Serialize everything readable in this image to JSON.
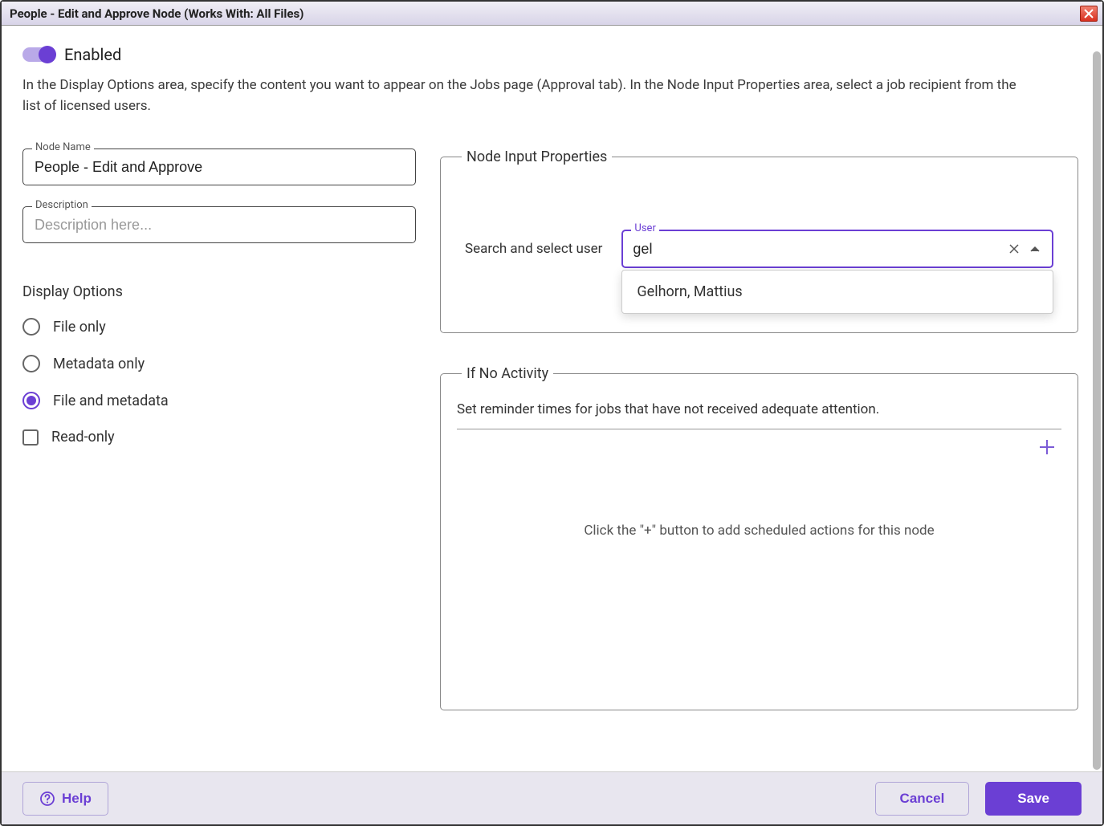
{
  "window": {
    "title": "People - Edit and Approve Node (Works With: All Files)"
  },
  "toggle": {
    "label": "Enabled",
    "state": "on"
  },
  "intro": "In the Display Options area, specify the content you want to appear on the Jobs page (Approval tab). In the Node Input Properties area, select a job recipient from the list of licensed users.",
  "fields": {
    "node_name": {
      "label": "Node Name",
      "value": "People - Edit and Approve"
    },
    "description": {
      "label": "Description",
      "placeholder": "Description here...",
      "value": ""
    }
  },
  "display_options": {
    "title": "Display Options",
    "items": [
      {
        "label": "File only",
        "selected": false
      },
      {
        "label": "Metadata only",
        "selected": false
      },
      {
        "label": "File and metadata",
        "selected": true
      }
    ],
    "readonly": {
      "label": "Read-only",
      "checked": false
    }
  },
  "node_input_props": {
    "legend": "Node Input Properties",
    "search_label": "Search and select user",
    "user_field_label": "User",
    "user_value": "gel",
    "dropdown_items": [
      "Gelhorn, Mattius"
    ]
  },
  "if_no_activity": {
    "legend": "If No Activity",
    "desc": "Set reminder times for jobs that have not received adequate attention.",
    "empty_text": "Click the \"+\" button to add scheduled actions for this node"
  },
  "footer": {
    "help": "Help",
    "cancel": "Cancel",
    "save": "Save"
  }
}
